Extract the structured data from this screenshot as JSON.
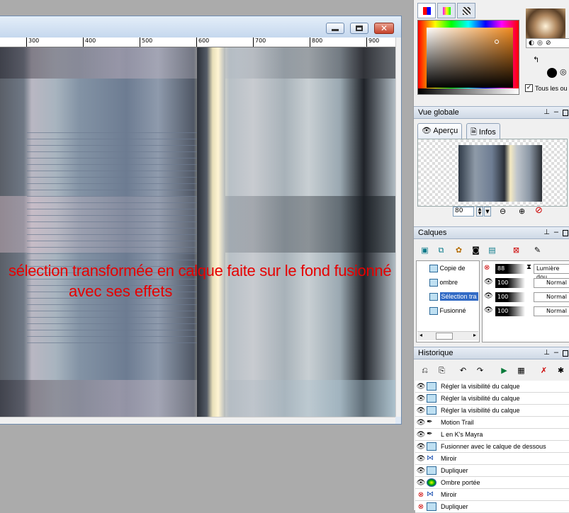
{
  "ruler": {
    "ticks": [
      "300",
      "400",
      "500",
      "600",
      "700",
      "800",
      "900"
    ]
  },
  "overlay": {
    "line1": "sélection transformée en calque faite sur le fond fusionné",
    "line2": "avec ses effets"
  },
  "color_panel": {
    "transparent_label": "Tous les ou"
  },
  "overview": {
    "title": "Vue globale",
    "tab_preview": "Aperçu",
    "tab_info": "Infos",
    "zoom_value": "80"
  },
  "layers": {
    "title": "Calques",
    "items": [
      {
        "name": "Copie de",
        "opacity": "88",
        "mode": "Lumière dou"
      },
      {
        "name": "ombre",
        "opacity": "100",
        "mode": "Normal"
      },
      {
        "name": "Sélection tra",
        "opacity": "100",
        "mode": "Normal"
      },
      {
        "name": "Fusionné",
        "opacity": "100",
        "mode": "Normal"
      }
    ]
  },
  "history": {
    "title": "Historique",
    "items": [
      "Régler la visibilité du calque",
      "Régler la visibilité du calque",
      "Régler la visibilité du calque",
      "Motion Trail",
      "L en K's Mayra",
      "Fusionner avec le calque de dessous",
      "Miroir",
      "Dupliquer",
      "Ombre portée",
      "Miroir",
      "Dupliquer"
    ]
  }
}
